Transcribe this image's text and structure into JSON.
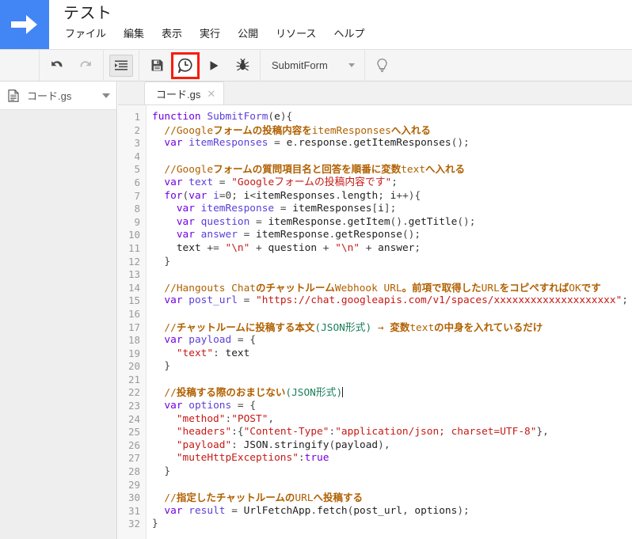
{
  "app": {
    "logo_icon": "apps-script-arrow-logo",
    "accent_color": "#4285f4",
    "highlight_color": "#f81c0b"
  },
  "header": {
    "doc_title": "テスト",
    "menu": [
      {
        "label": "ファイル",
        "name": "menu-file"
      },
      {
        "label": "編集",
        "name": "menu-edit"
      },
      {
        "label": "表示",
        "name": "menu-view"
      },
      {
        "label": "実行",
        "name": "menu-run"
      },
      {
        "label": "公開",
        "name": "menu-publish"
      },
      {
        "label": "リソース",
        "name": "menu-resources"
      },
      {
        "label": "ヘルプ",
        "name": "menu-help"
      }
    ]
  },
  "toolbar": {
    "undo_icon": "undo-icon",
    "redo_icon": "redo-icon",
    "indent_icon": "indent-format-icon",
    "save_icon": "save-floppy-icon",
    "triggers_icon": "clock-speech-bubble-triggers-icon",
    "run_icon": "run-play-icon",
    "debug_icon": "debug-bug-icon",
    "lightbulb_icon": "lightbulb-icon",
    "function_select": "SubmitForm",
    "function_caret_icon": "chevron-down-icon"
  },
  "sidebar": {
    "file_icon": "document-file-icon",
    "file_name": "コード.gs",
    "file_caret_icon": "chevron-down-icon"
  },
  "editor": {
    "tab_label": "コード.gs",
    "tab_close_icon": "close-x-icon",
    "line_numbers": [
      "1",
      "2",
      "3",
      "4",
      "5",
      "6",
      "7",
      "8",
      "9",
      "10",
      "11",
      "12",
      "13",
      "14",
      "15",
      "16",
      "17",
      "18",
      "19",
      "20",
      "21",
      "22",
      "23",
      "24",
      "25",
      "26",
      "27",
      "28",
      "29",
      "30",
      "31",
      "32"
    ],
    "lines": [
      "function SubmitForm(e){",
      "  //Googleフォームの投稿内容をitemResponsesへ入れる",
      "  var itemResponses = e.response.getItemResponses();",
      "",
      "  //Googleフォームの質問項目名と回答を順番に変数textへ入れる",
      "  var text = \"Googleフォームの投稿内容です\";",
      "  for(var i=0; i<itemResponses.length; i++){",
      "    var itemResponse = itemResponses[i];",
      "    var question = itemResponse.getItem().getTitle();",
      "    var answer = itemResponse.getResponse();",
      "    text += \"\\n\" + question + \"\\n\" + answer;",
      "  }",
      "",
      "  //Hangouts Chatのチャットルー厶Webhook URL。前項で取得したURLをコピペすればOKです",
      "  var post_url = \"https://chat.googleapis.com/v1/spaces/xxxxxxxxxxxxxxxxxxxx\";",
      "",
      "  //チャットルームに投稿する本文(JSON形式) → 変数textの中身を入れているだけ",
      "  var payload = {",
      "    \"text\": text",
      "  }",
      "",
      "  //投稿する際のおまじない(JSON形式)",
      "  var options = {",
      "    \"method\":\"POST\",",
      "    \"headers\":{\"Content-Type\":\"application/json; charset=UTF-8\"},",
      "    \"payload\": JSON.stringify(payload),",
      "    \"muteHttpExceptions\":true",
      "  }",
      "",
      "  //指定したチャットルームのURLへ投稿する",
      "  var result = UrlFetchApp.fetch(post_url, options);",
      "}"
    ],
    "cursor_line": 22
  }
}
